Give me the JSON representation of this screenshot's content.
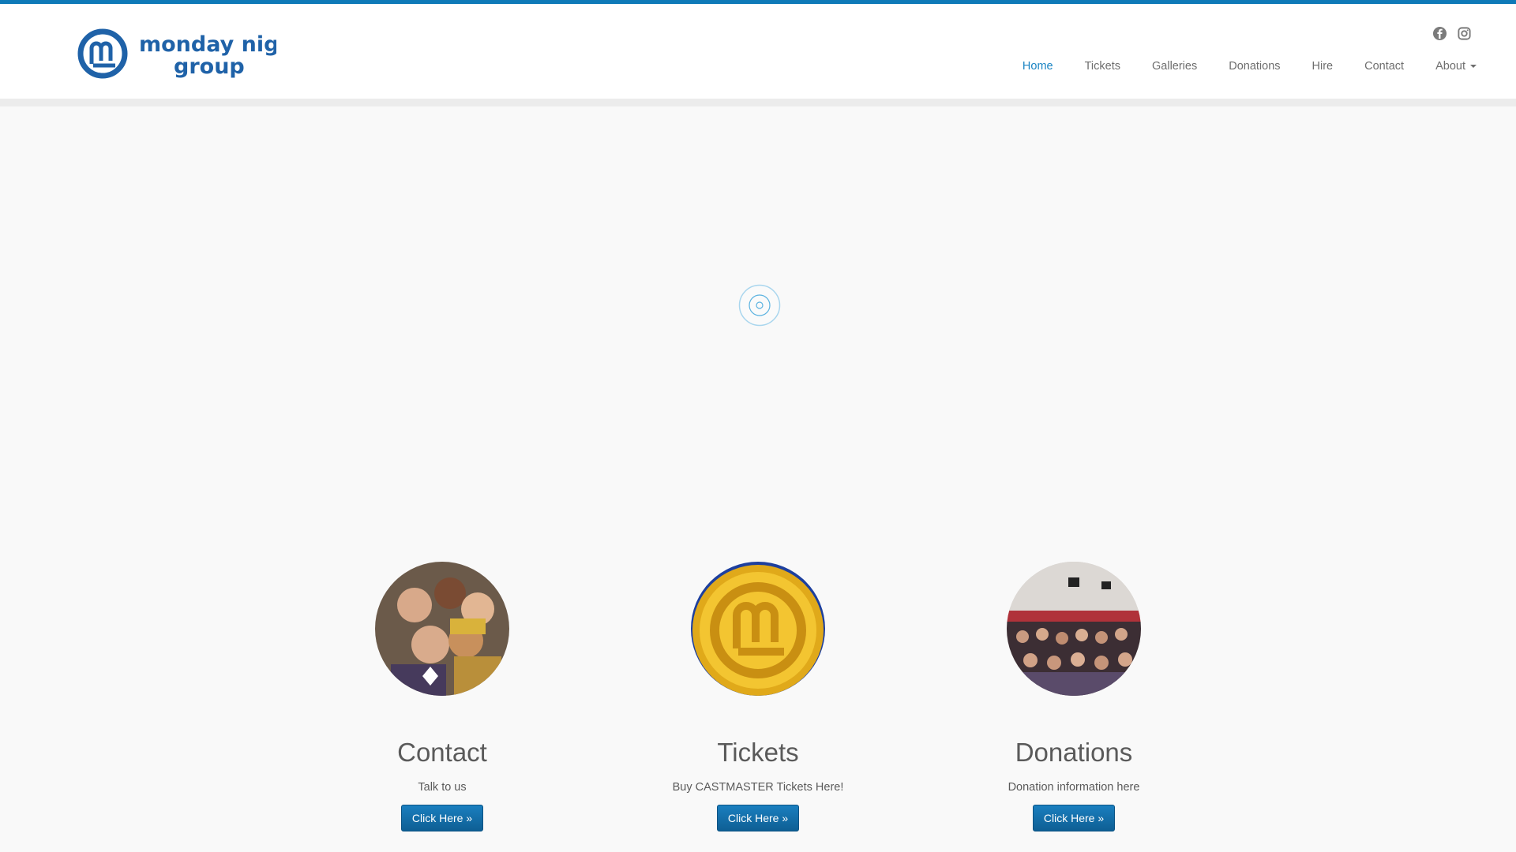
{
  "brand": {
    "name_line1": "monday night",
    "name_line2": "group",
    "color": "#1f62a8"
  },
  "social": [
    {
      "icon": "facebook-icon"
    },
    {
      "icon": "instagram-icon"
    }
  ],
  "nav": {
    "items": [
      {
        "label": "Home",
        "active": true
      },
      {
        "label": "Tickets"
      },
      {
        "label": "Galleries"
      },
      {
        "label": "Donations"
      },
      {
        "label": "Hire"
      },
      {
        "label": "Contact"
      },
      {
        "label": "About",
        "dropdown": true
      }
    ]
  },
  "slider": {
    "loading_icon": "spinner-icon"
  },
  "features": [
    {
      "title": "Contact",
      "text": "Talk to us",
      "button": "Click Here »",
      "image": "cast-photo"
    },
    {
      "title": "Tickets",
      "text": "Buy CASTMASTER Tickets Here!",
      "button": "Click Here »",
      "image": "gold-logo-coin"
    },
    {
      "title": "Donations",
      "text": "Donation information here",
      "button": "Click Here »",
      "image": "audience-photo"
    }
  ],
  "colors": {
    "accent": "#1a84c3",
    "topbar": "#0f7ab8",
    "button": "#0e5f94",
    "background": "#f9f9f9"
  }
}
